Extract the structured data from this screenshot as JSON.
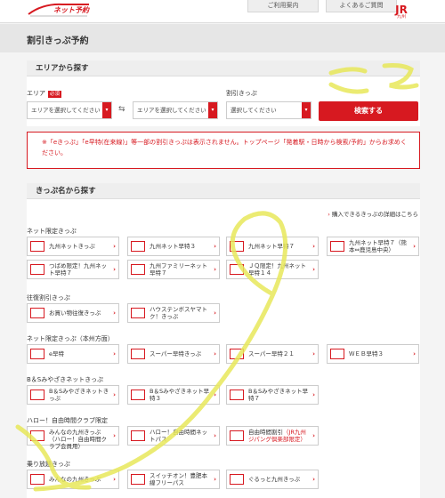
{
  "header": {
    "logo_text": "ネット予約",
    "links": [
      "ご利用案内",
      "よくあるご質問"
    ],
    "jr_logo": "JR",
    "jr_sub": "九州",
    "brand_color": "#d71920"
  },
  "page_title": "割引きっぷ予約",
  "area_search": {
    "title": "エリアから探す",
    "area_label": "エリア",
    "required": "必須",
    "from_placeholder": "エリアを選択してください",
    "to_placeholder": "エリアを選択してください",
    "swap_icon": "⇆",
    "ticket_label": "割引きっぷ",
    "ticket_placeholder": "選択してください",
    "search_button": "検索する"
  },
  "notice": "※「eきっぷ」「e早特(在来線)」等一部の割引きっぷは表示されません。トップページ「発着駅・日時から検索/予約」からお求めください。",
  "name_search": {
    "title": "きっぷ名から探す",
    "detail_link": "購入できるきっぷの詳細はこちら"
  },
  "groups": [
    {
      "title": "ネット限定きっぷ",
      "tiles": [
        {
          "icon": "netkippu",
          "name": "九州ネットきっぷ",
          "two": false
        },
        {
          "icon": "hayatoku",
          "name": "九州ネット早特３",
          "two": false
        },
        {
          "icon": "hayatoku",
          "name": "九州ネット早特７",
          "two": false
        },
        {
          "icon": "hayatoku",
          "name": "九州ネット早特７（熊本⇔鹿児島中央）",
          "two": true
        },
        {
          "icon": "otoku",
          "name": "つばめ限定！九州ネット早特７",
          "two": true
        },
        {
          "icon": "hayatoku",
          "name": "九州ファミリーネット早特７",
          "two": true
        },
        {
          "icon": "hayatoku",
          "name": "ＪＱ限定！九州ネット早特１４",
          "two": true
        }
      ]
    },
    {
      "title": "往復割引きっぷ",
      "tiles": [
        {
          "icon": "kaimono",
          "name": "お買い物往復きっぷ",
          "two": false
        },
        {
          "icon": "huis",
          "name": "ハウステンボスヤマトク！きっぷ",
          "two": true
        }
      ]
    },
    {
      "title": "ネット限定きっぷ（本州方面）",
      "tiles": [
        {
          "icon": "ehayatoku",
          "name": "e早特",
          "two": false
        },
        {
          "icon": "super",
          "name": "スーパー早特きっぷ",
          "two": false
        },
        {
          "icon": "hayatoku21",
          "name": "スーパー早特２１",
          "two": false
        },
        {
          "icon": "web",
          "name": "ＷＥＢ早特３",
          "two": false
        }
      ]
    },
    {
      "title": "B＆Sみやざきネットきっぷ",
      "tiles": [
        {
          "icon": "bs",
          "name": "B＆Sみやざきネットきっぷ",
          "two": true
        },
        {
          "icon": "bs",
          "name": "B＆Sみやざきネット早特３",
          "two": true
        },
        {
          "icon": "bs",
          "name": "B＆Sみやざきネット早特７",
          "two": true
        }
      ]
    },
    {
      "title": "ハロー！自由時間クラブ限定",
      "tiles": [
        {
          "icon": "hello",
          "name": "みんなの九州きっぷ（ハロー！自由時間クラブ会員用）",
          "two": true
        },
        {
          "icon": "hello",
          "name": "ハロー！自由時間ネットパス",
          "two": true
        },
        {
          "icon": "hello",
          "name": "自由時間割引（JR九州ジパング倶楽部限定）",
          "two": true,
          "rich": true,
          "plain": "自由時間割引",
          "red": "（JR九州ジパング倶楽部限定）"
        }
      ]
    },
    {
      "title": "乗り放題きっぷ",
      "tiles": [
        {
          "icon": "minna",
          "name": "みんなの九州きっぷ",
          "two": false
        },
        {
          "icon": "switch",
          "name": "スイッチオン！豊肥本線フリーパス",
          "two": true
        },
        {
          "icon": "guru",
          "name": "ぐるっと九州きっぷ",
          "two": false
        }
      ]
    }
  ],
  "annotation_color": "#e8e85a"
}
